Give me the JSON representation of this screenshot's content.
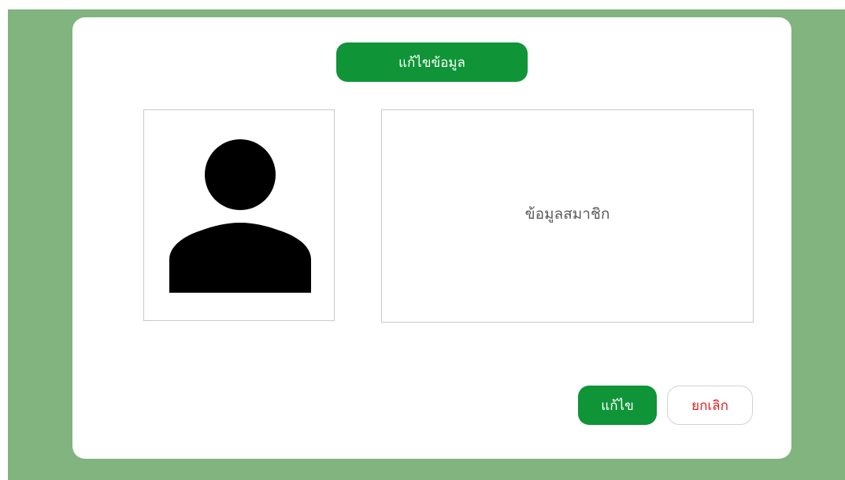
{
  "dialog": {
    "title": "แก้ไขข้อมูล",
    "avatar_icon": "user-silhouette-icon",
    "member_info_label": "ข้อมูลสมาชิก",
    "edit_button": "แก้ไข",
    "cancel_button": "ยกเลิก"
  },
  "colors": {
    "backdrop": "#81b47f",
    "primary_green": "#0f9437",
    "cancel_red": "#e02020",
    "panel_border": "#c9c9c9"
  }
}
